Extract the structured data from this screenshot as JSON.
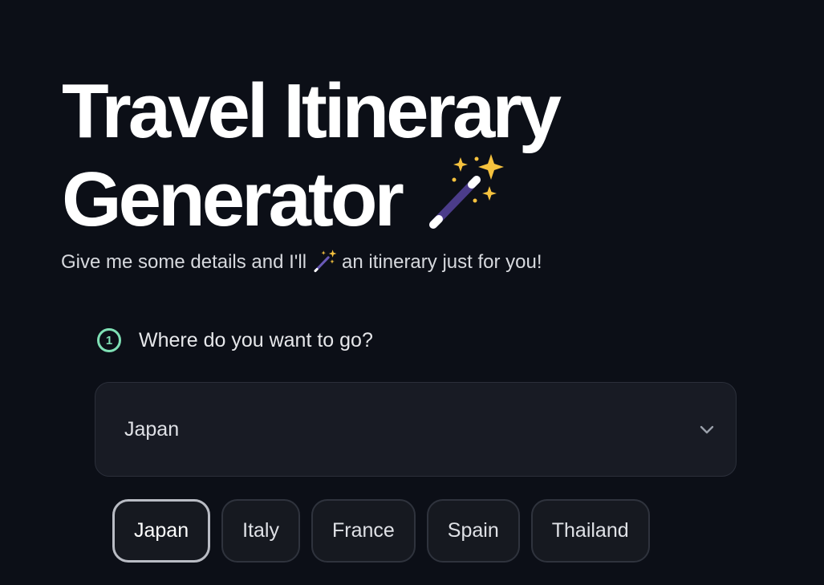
{
  "header": {
    "title_line1": "Travel Itinerary",
    "title_line2": "Generator",
    "title_icon": "magic-wand-icon",
    "subtitle_before": "Give me some details and I'll",
    "subtitle_icon": "magic-wand-icon",
    "subtitle_after": "an itinerary just for you!"
  },
  "step": {
    "number": "1",
    "question": "Where do you want to go?"
  },
  "destination_select": {
    "selected": "Japan",
    "icon": "chevron-down-icon"
  },
  "chips": [
    {
      "label": "Japan",
      "selected": true
    },
    {
      "label": "Italy",
      "selected": false
    },
    {
      "label": "France",
      "selected": false
    },
    {
      "label": "Spain",
      "selected": false
    },
    {
      "label": "Thailand",
      "selected": false
    }
  ],
  "colors": {
    "background": "#0c0f17",
    "accent_green": "#7fe0b5",
    "wand_stick": "#4b3c8a",
    "sparkle": "#f6c23e"
  }
}
